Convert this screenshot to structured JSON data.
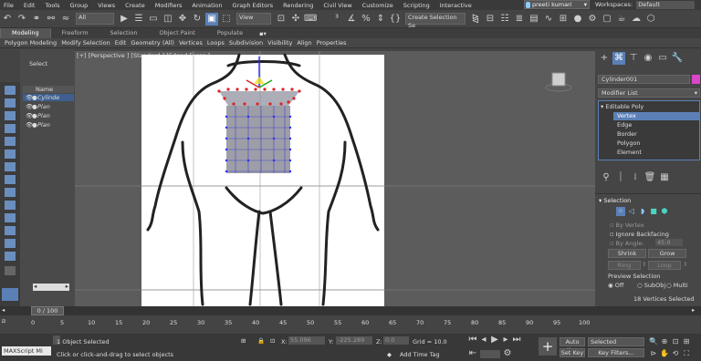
{
  "menu": [
    "File",
    "Edit",
    "Tools",
    "Group",
    "Views",
    "Create",
    "Modifiers",
    "Animation",
    "Graph Editors",
    "Rendering",
    "Civil View",
    "Customize",
    "Scripting",
    "Interactive"
  ],
  "user": "preeti kumari",
  "workspaces_label": "Workspaces:",
  "workspaces_value": "Default",
  "toolbar": {
    "filter": "All",
    "refcoord": "View",
    "selection_set": "Create Selection Se"
  },
  "ribbon": {
    "tabs": [
      "Modeling",
      "Freeform",
      "Selection",
      "Object Paint",
      "Populate"
    ],
    "active_tab": "Modeling",
    "sub_items": [
      "Polygon Modeling",
      "Modify Selection",
      "Edit",
      "Geometry (All)",
      "Vertices",
      "Loops",
      "Subdivision",
      "Visibility",
      "Align",
      "Properties"
    ]
  },
  "scene_explorer": {
    "select_label": "Select",
    "header": "Name (Sorted A",
    "items": [
      "Cylinde",
      "Plan",
      "Plan",
      "Plan"
    ]
  },
  "viewport": {
    "label": "[+] [Perspective ] [Standard ] [Edged Faces ]"
  },
  "command_panel": {
    "object_name": "Cylinder001",
    "object_color": "#d946c9",
    "modifier_list_label": "Modifier List",
    "stack_root": "Editable Poly",
    "sub_objects": [
      "Vertex",
      "Edge",
      "Border",
      "Polygon",
      "Element"
    ],
    "active_sub_object": "Vertex",
    "selection_rollout_title": "Selection",
    "by_vertex": "By Vertex",
    "ignore_backfacing": "Ignore Backfacing",
    "by_angle": "By Angle:",
    "angle_value": "45.0",
    "shrink": "Shrink",
    "grow": "Grow",
    "ring": "Ring",
    "loop": "Loop",
    "preview_selection": "Preview Selection",
    "preview_options": [
      "Off",
      "SubObj",
      "Multi"
    ],
    "selected_count": "18 Vertices Selected"
  },
  "timeline": {
    "frame": "0 / 100",
    "ticks": [
      "0",
      "5",
      "10",
      "15",
      "20",
      "25",
      "30",
      "35",
      "40",
      "45",
      "50",
      "55",
      "60",
      "65",
      "70",
      "75",
      "80",
      "85",
      "90",
      "95",
      "100"
    ]
  },
  "status": {
    "maxscript": "MAXScript Mi",
    "objects_selected": "1 Object Selected",
    "prompt": "Click or click-and-drag to select objects",
    "x_label": "X:",
    "x_value": "55.096",
    "y_label": "Y:",
    "y_value": "-225.289",
    "z_label": "Z:",
    "z_value": "0.0",
    "grid": "Grid = 10.0",
    "add_time_tag": "Add Time Tag",
    "auto_key": "Auto Key",
    "set_key": "Set Key",
    "selected": "Selected",
    "key_filters": "Key Filters..."
  }
}
